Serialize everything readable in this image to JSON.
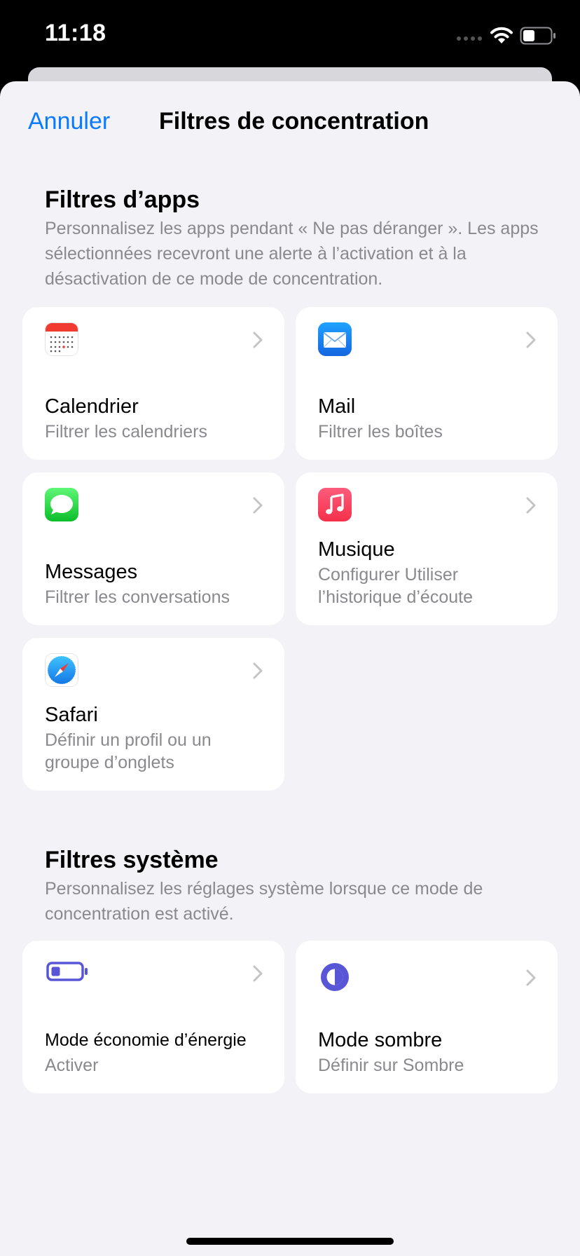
{
  "status": {
    "time": "11:18"
  },
  "nav": {
    "cancel": "Annuler",
    "title": "Filtres de concentration"
  },
  "app_filters": {
    "title": "Filtres d’apps",
    "description": "Personnalisez les apps pendant « Ne pas déranger ». Les apps sélectionnées recevront une alerte à l’activation et à la désactivation de ce mode de concentration.",
    "items": [
      {
        "icon": "calendar-icon",
        "title": "Calendrier",
        "subtitle": "Filtrer les calendriers"
      },
      {
        "icon": "mail-icon",
        "title": "Mail",
        "subtitle": "Filtrer les boîtes"
      },
      {
        "icon": "messages-icon",
        "title": "Messages",
        "subtitle": "Filtrer les conversations"
      },
      {
        "icon": "music-icon",
        "title": "Musique",
        "subtitle": "Configurer Utiliser l’historique d’écoute"
      },
      {
        "icon": "safari-icon",
        "title": "Safari",
        "subtitle": "Définir un profil ou un groupe d’onglets"
      }
    ]
  },
  "system_filters": {
    "title": "Filtres système",
    "description": "Personnalisez les réglages système lorsque ce mode de concentration est activé.",
    "items": [
      {
        "icon": "low-power-battery-icon",
        "title": "Mode économie d’énergie",
        "subtitle": "Activer"
      },
      {
        "icon": "dark-mode-icon",
        "title": "Mode sombre",
        "subtitle": "Définir sur Sombre"
      }
    ]
  },
  "colors": {
    "accent": "#0a7aff",
    "background": "#f2f2f7",
    "secondary_text": "#8a8a8e",
    "system_icon": "#5856d6"
  }
}
